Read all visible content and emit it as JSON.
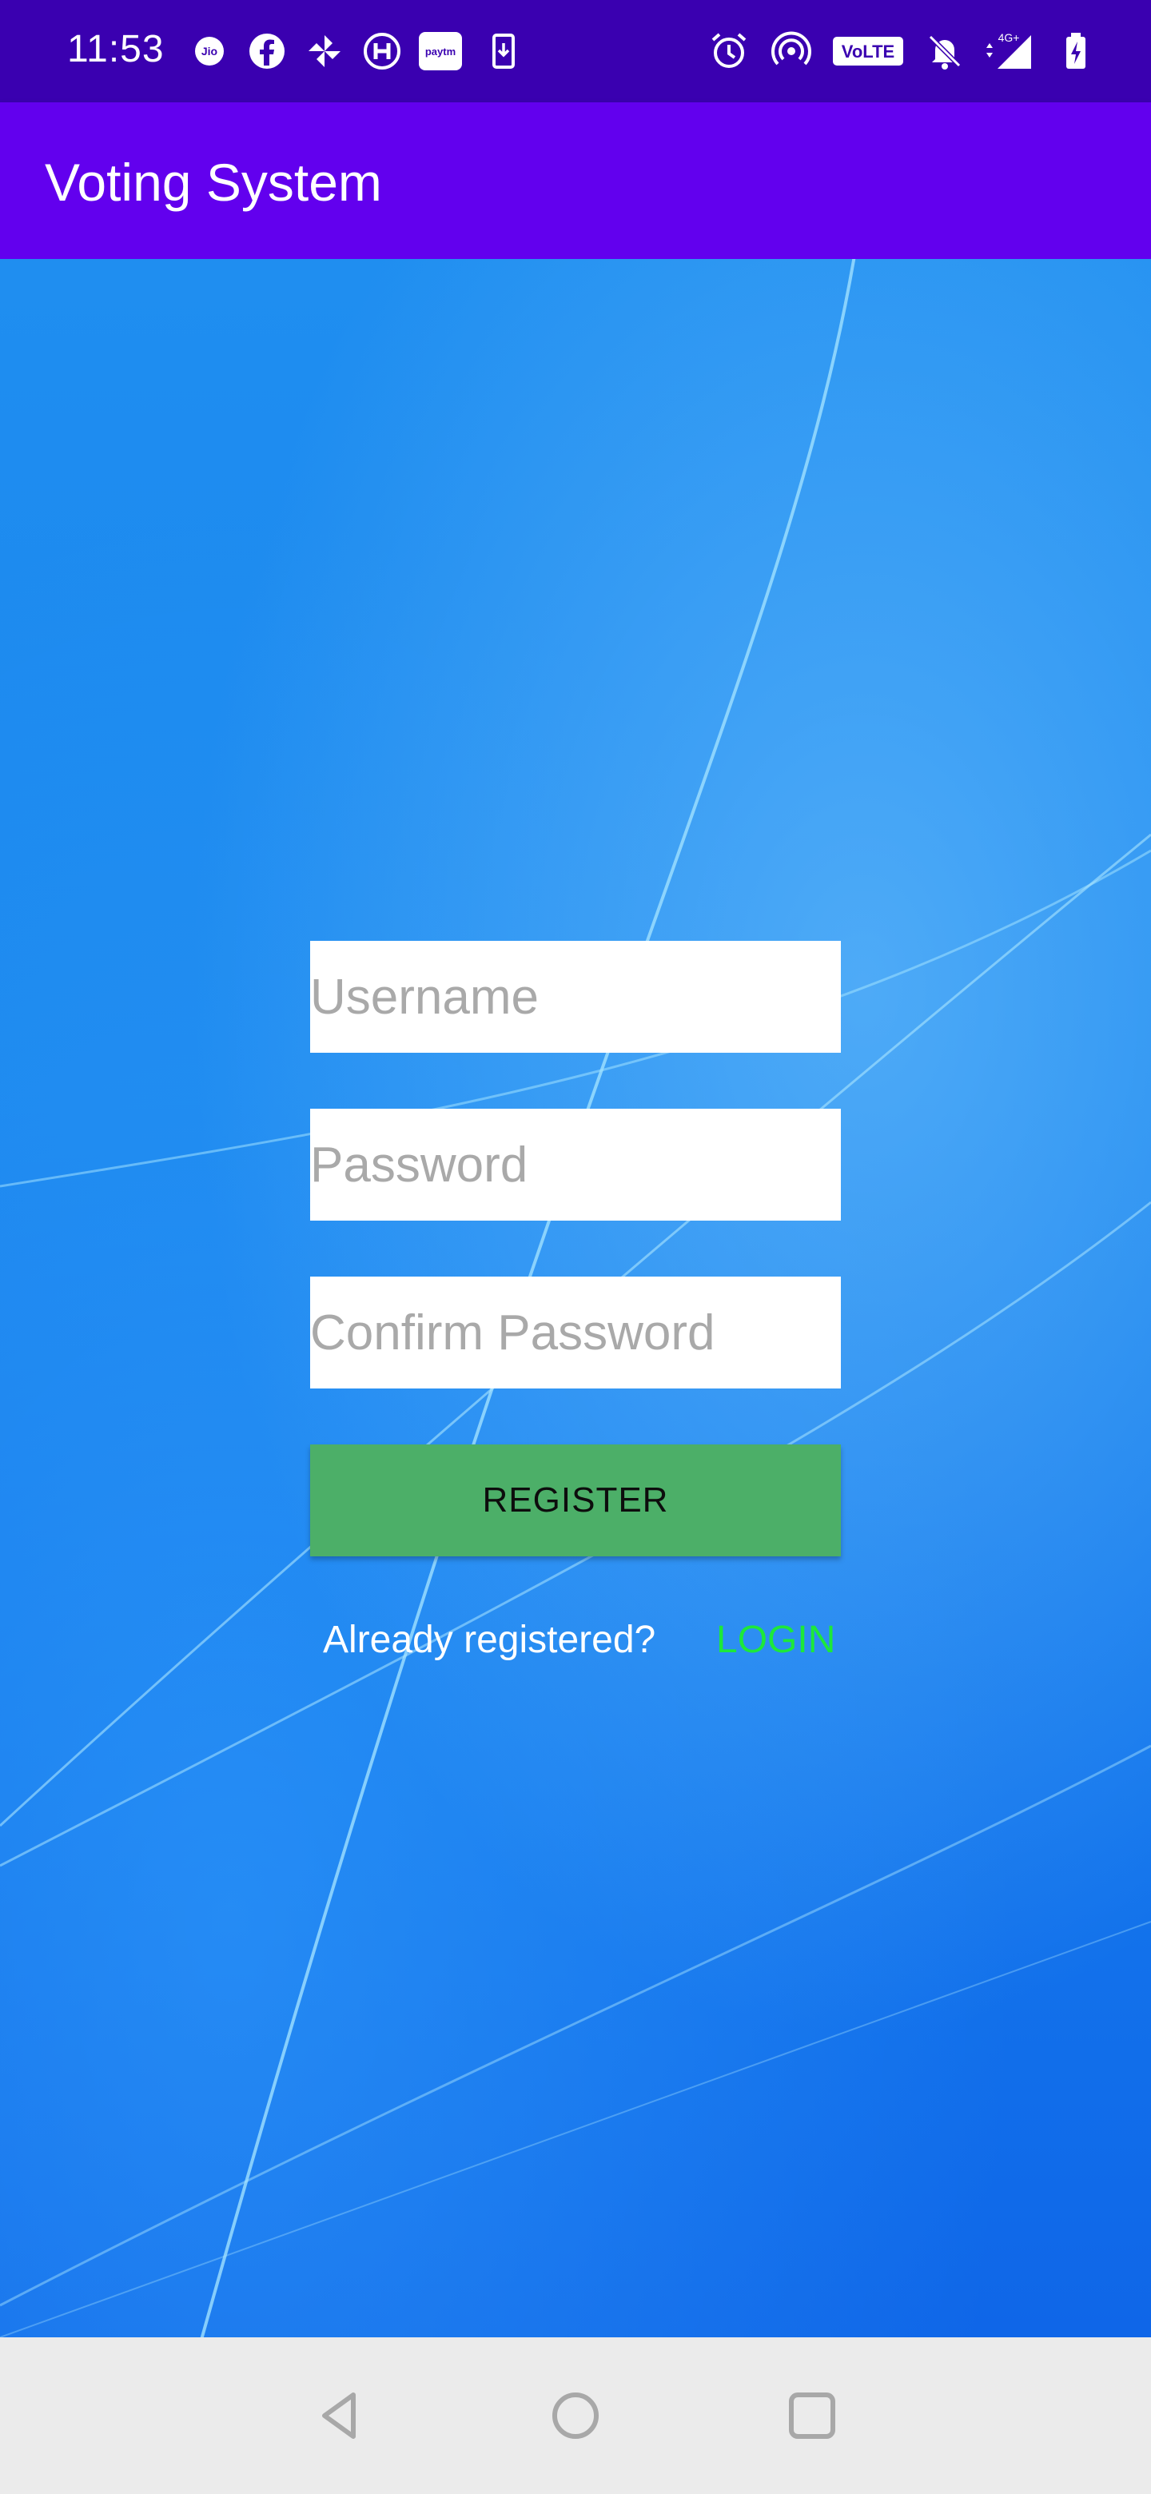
{
  "status_bar": {
    "time": "11:53",
    "left_icons": [
      "jio-icon",
      "facebook-icon",
      "pinwheel-icon",
      "hotstar-icon",
      "paytm-icon",
      "download-icon"
    ],
    "right_icons": [
      "alarm-icon",
      "hotspot-icon",
      "volte-icon",
      "bell-off-icon",
      "signal-4g-icon",
      "battery-charging-icon"
    ],
    "volte_label": "VoLTE",
    "network_label": "4G+"
  },
  "app_bar": {
    "title": "Voting System"
  },
  "form": {
    "username_placeholder": "Username",
    "password_placeholder": "Password",
    "confirm_placeholder": "Confirm Password",
    "register_label": "REGISTER",
    "already_registered": "Already registered?",
    "login_label": "LOGIN"
  },
  "colors": {
    "status_bar": "#3a00b0",
    "app_bar": "#6200ee",
    "register_button": "#4caf68",
    "login_link": "#1de83a",
    "nav_bar": "#ebebeb"
  },
  "nav_bar": {
    "buttons": [
      "back-icon",
      "home-icon",
      "recents-icon"
    ]
  }
}
